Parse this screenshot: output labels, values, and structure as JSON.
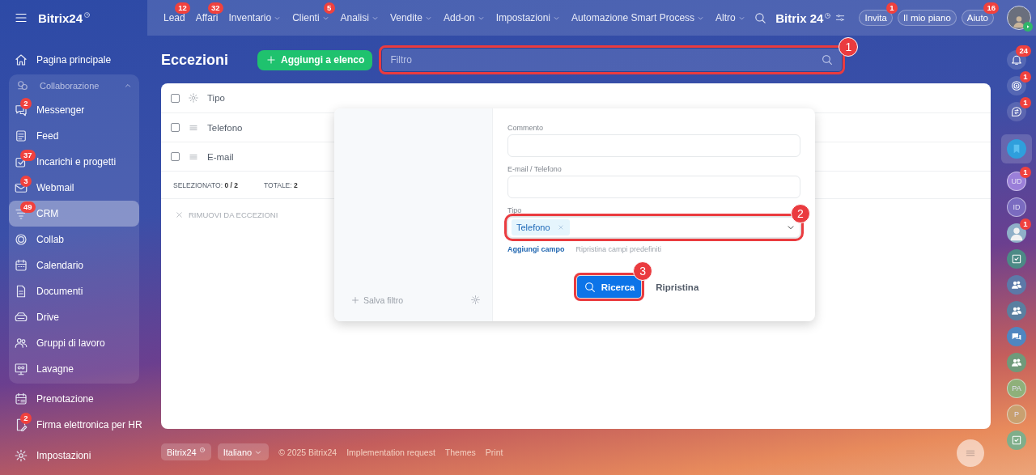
{
  "top_bar": {
    "logo": "Bitrix24",
    "nav": [
      {
        "label": "Lead",
        "badge": "12",
        "has_menu": false
      },
      {
        "label": "Affari",
        "badge": "32",
        "has_menu": false
      },
      {
        "label": "Inventario",
        "has_menu": true
      },
      {
        "label": "Clienti",
        "badge": "5",
        "has_menu": true
      },
      {
        "label": "Analisi",
        "has_menu": true
      },
      {
        "label": "Vendite",
        "has_menu": true
      },
      {
        "label": "Add-on",
        "has_menu": true
      },
      {
        "label": "Impostazioni",
        "has_menu": true
      },
      {
        "label": "Automazione Smart Process",
        "has_menu": true
      },
      {
        "label": "Altro",
        "has_menu": true
      }
    ],
    "brand": "Bitrix 24",
    "buttons": [
      {
        "label": "Invita",
        "badge": "1"
      },
      {
        "label": "Il mio piano"
      },
      {
        "label": "Aiuto",
        "badge": "16"
      }
    ]
  },
  "sidebar": {
    "items": [
      {
        "kind": "item",
        "label": "Pagina principale",
        "selected": false
      },
      {
        "kind": "group",
        "label": "Collaborazione",
        "expanded": true,
        "children": [
          {
            "label": "Messenger",
            "badge": "2",
            "selected": false
          },
          {
            "label": "Feed",
            "selected": false
          },
          {
            "label": "Incarichi e progetti",
            "badge": "37",
            "selected": false
          },
          {
            "label": "Webmail",
            "badge": "3",
            "selected": false
          },
          {
            "label": "CRM",
            "badge": "49",
            "selected": true
          },
          {
            "label": "Collab",
            "selected": false
          },
          {
            "label": "Calendario",
            "selected": false
          },
          {
            "label": "Documenti",
            "selected": false
          },
          {
            "label": "Drive",
            "selected": false
          },
          {
            "label": "Gruppi di lavoro",
            "selected": false
          },
          {
            "label": "Lavagne",
            "selected": false
          }
        ]
      },
      {
        "kind": "item",
        "label": "Prenotazione",
        "selected": false
      },
      {
        "kind": "item",
        "label": "Firma elettronica per HR",
        "badge": "2",
        "selected": false
      },
      {
        "kind": "settings",
        "label": "Impostazioni",
        "selected": false
      }
    ]
  },
  "page": {
    "title": "Eccezioni",
    "add_button": "Aggiungi a elenco",
    "filter": {
      "placeholder": "Filtro",
      "callout": "1"
    }
  },
  "table": {
    "header": {
      "label": "Tipo",
      "checked": false
    },
    "rows": [
      {
        "label": "Telefono",
        "checked": false
      },
      {
        "label": "E-mail",
        "checked": false
      }
    ],
    "summary": {
      "selected_label": "SELEZIONATO:",
      "selected_value": "0 / 2",
      "total_label": "TOTALE:",
      "total_value": "2"
    },
    "action": "RIMUOVI DA ECCEZIONI"
  },
  "filter_popup": {
    "save_filter": "Salva filtro",
    "fields": [
      {
        "kind": "text",
        "label": "Commento"
      },
      {
        "kind": "text",
        "label": "E-mail / Telefono"
      },
      {
        "kind": "select",
        "label": "Tipo",
        "tags": [
          "Telefono"
        ],
        "callout": "2"
      }
    ],
    "add_field": "Aggiungi campo",
    "reset_fields": "Ripristina campi predefiniti",
    "search_button": {
      "label": "Ricerca",
      "callout": "3"
    },
    "reset_button": "Ripristina"
  },
  "footer": {
    "logo_button": "Bitrix24",
    "language": "Italiano",
    "copyright": "© 2025 Bitrix24",
    "links": [
      "Implementation request",
      "Themes",
      "Print"
    ]
  },
  "right_rail": {
    "items": [
      {
        "kind": "bell",
        "badge": "24"
      },
      {
        "kind": "target",
        "badge": "1"
      },
      {
        "kind": "chat",
        "badge": "1"
      },
      {
        "kind": "bookmark",
        "selected": true
      },
      {
        "kind": "initials",
        "text": "UD",
        "badge": "1",
        "color": "#9b7fd9"
      },
      {
        "kind": "initials",
        "text": "ID",
        "color": "#7a6bc0"
      },
      {
        "kind": "photo",
        "badge": "1"
      },
      {
        "kind": "task",
        "color": "#4c8a86"
      },
      {
        "kind": "group",
        "color": "#5c79a8"
      },
      {
        "kind": "group",
        "color": "#5a7fa0"
      },
      {
        "kind": "comments",
        "color": "#4f86c0"
      },
      {
        "kind": "group",
        "color": "#6f9a7a"
      },
      {
        "kind": "initials",
        "text": "PA",
        "color": "#8fb07a"
      },
      {
        "kind": "initials",
        "text": "P",
        "color": "#c8a070"
      },
      {
        "kind": "task",
        "color": "#7fae8a"
      }
    ]
  }
}
